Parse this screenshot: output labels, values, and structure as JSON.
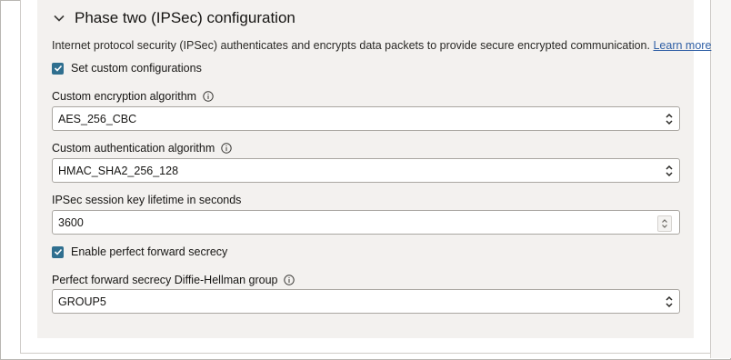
{
  "section": {
    "title": "Phase two (IPSec) configuration",
    "description": "Internet protocol security (IPSec) authenticates and encrypts data packets to provide secure encrypted communication.",
    "learn_more": "Learn more"
  },
  "custom_config": {
    "label": "Set custom configurations",
    "checked": true
  },
  "encryption": {
    "label": "Custom encryption algorithm",
    "value": "AES_256_CBC"
  },
  "authentication": {
    "label": "Custom authentication algorithm",
    "value": "HMAC_SHA2_256_128"
  },
  "lifetime": {
    "label": "IPSec session key lifetime in seconds",
    "value": "3600"
  },
  "pfs": {
    "label": "Enable perfect forward secrecy",
    "checked": true
  },
  "dh_group": {
    "label": "Perfect forward secrecy Diffie-Hellman group",
    "value": "GROUP5"
  },
  "colors": {
    "accent": "#2f6f8f",
    "link": "#2f5fa5",
    "panel": "#f3f1ef"
  },
  "icons": [
    "chevron-down-icon",
    "checkmark-icon",
    "info-icon",
    "select-updown-icon",
    "stepper-icon"
  ]
}
